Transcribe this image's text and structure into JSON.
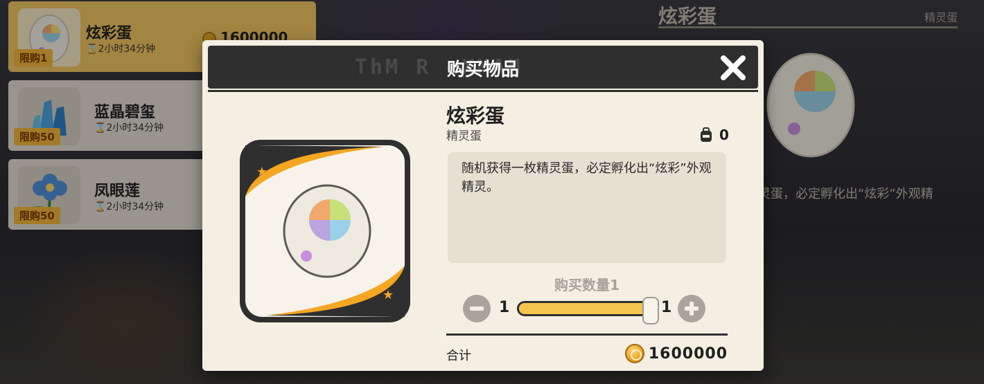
{
  "shop_list": {
    "items": [
      {
        "name": "炫彩蛋",
        "timer": "2小时34分钟",
        "limit": "限购1",
        "price": "1600000",
        "icon": "rainbow-egg-icon",
        "selected": true
      },
      {
        "name": "蓝晶碧玺",
        "timer": "2小时34分钟",
        "limit": "限购50",
        "icon": "blue-crystal-icon",
        "selected": false
      },
      {
        "name": "凤眼莲",
        "timer": "2小时34分钟",
        "limit": "限购50",
        "icon": "blue-flower-icon",
        "selected": false
      }
    ]
  },
  "detail_panel": {
    "title": "炫彩蛋",
    "subtitle": "精灵蛋",
    "description_fragment": "灵蛋，必定孵化出“炫彩”外观精"
  },
  "modal": {
    "header_bg_text": "ThM R   +XMAM",
    "title": "购买物品",
    "item_name": "炫彩蛋",
    "item_type": "精灵蛋",
    "owned_count": "0",
    "description": "随机获得一枚精灵蛋，必定孵化出“炫彩”外观精灵。",
    "quantity_label": "购买数量1",
    "quantity_min": "1",
    "quantity_max": "1",
    "quantity_fraction": 1.0,
    "total_label": "合计",
    "total_amount": "1600000"
  },
  "colors": {
    "accent": "#f5c64d",
    "header": "#2f2f2f",
    "panel": "#f4efe2",
    "coin": "#e9a82a"
  }
}
